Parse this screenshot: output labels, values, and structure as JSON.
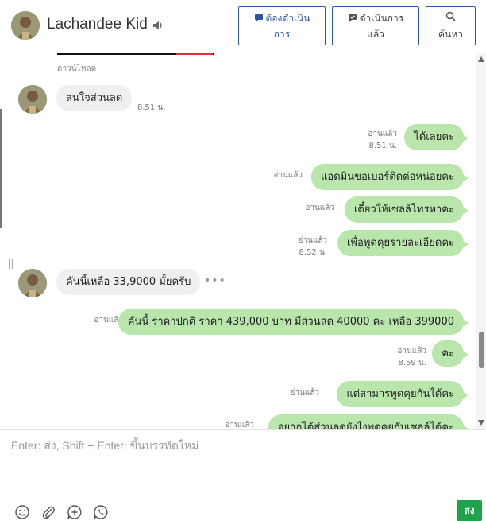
{
  "header": {
    "contact_name": "Lachandee Kid",
    "actions": {
      "todo_label_line1": "ต้องดำเนิน",
      "todo_label_line2": "การ",
      "done_label_line1": "ดำเนินการ",
      "done_label_line2": "แล้ว",
      "search_label": "ค้นหา"
    }
  },
  "chat": {
    "download_label": "ดาวน์โหลด",
    "messages": [
      {
        "direction": "in",
        "text": "สนใจส่วนลด",
        "time": "8.51 น."
      },
      {
        "direction": "out",
        "text": "ได้เลยคะ",
        "read": "อ่านแล้ว",
        "time": "8.51 น."
      },
      {
        "direction": "out",
        "text": "แอดมินขอเบอร์ติดต่อหน่อยคะ",
        "read": "อ่านแล้ว",
        "time": ""
      },
      {
        "direction": "out",
        "text": "เดี๋ยวให้เซลล์โทรหาคะ",
        "read": "อ่านแล้ว",
        "time": ""
      },
      {
        "direction": "out",
        "text": "เพื่อพูดคุยรายละเอียดคะ",
        "read": "อ่านแล้ว",
        "time": "8.52 น."
      },
      {
        "direction": "in",
        "text": "คันนี้เหลือ 33,9000 มั้ยครับ",
        "time": ""
      },
      {
        "direction": "out",
        "text": "คันนี้ ราคาปกติ ราคา 439,000 บาท มีส่วนลด 40000 คะ เหลือ 399000",
        "read": "อ่านแล้ว",
        "time": ""
      },
      {
        "direction": "out",
        "text": "คะ",
        "read": "อ่านแล้ว",
        "time": "8.59 น."
      },
      {
        "direction": "out",
        "text": "แต่สามารพูดคุยกันได้คะ",
        "read": "อ่านแล้ว",
        "time": ""
      },
      {
        "direction": "out",
        "text": "อยากได้ส่วนลดยังไงพูดคุยกับเซลล์ได้คะ",
        "read": "อ่านแล้ว",
        "time": ""
      }
    ]
  },
  "composer": {
    "placeholder": "Enter: ส่ง, Shift + Enter: ขึ้นบรรทัดใหม่",
    "send_label": "ส่ง"
  },
  "icons": {
    "sound": "speaker-icon",
    "todo": "chat-bubble-icon",
    "done": "check-bubble-icon",
    "search": "search-icon",
    "emoji": "smile-icon",
    "attach": "paperclip-icon",
    "add": "plus-bubble-icon",
    "whatsapp": "phone-bubble-icon"
  },
  "colors": {
    "outgoing_bubble": "#b9e6ab",
    "incoming_bubble": "#efefef",
    "accent_border": "#2f55a8",
    "send_button": "#1fa34a"
  }
}
